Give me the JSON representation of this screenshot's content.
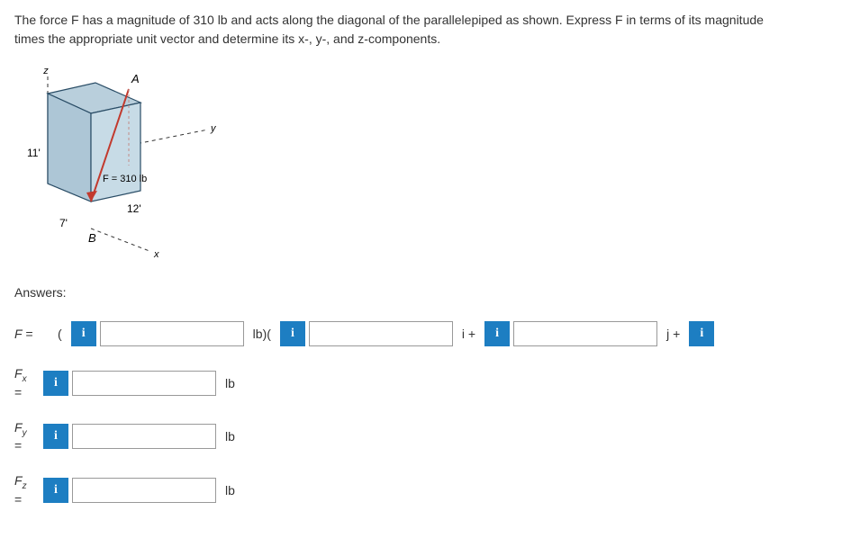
{
  "problem": {
    "line1": "The force F has a magnitude of 310 lb and acts along the diagonal of the parallelepiped as shown. Express F in terms of its magnitude",
    "line2": "times the appropriate unit vector and determine its x-, y-, and z-components."
  },
  "diagram": {
    "z_label": "z",
    "y_label": "y",
    "x_label": "x",
    "A_label": "A",
    "B_label": "B",
    "height": "11'",
    "width": "7'",
    "depth": "12'",
    "force_label": "F = 310 lb"
  },
  "answers_label": "Answers:",
  "rows": {
    "F": {
      "label": "F =",
      "open_paren": "(",
      "after1": "lb)(",
      "after2": "i +",
      "after3": "j +",
      "info_text": "i"
    },
    "Fx": {
      "var": "F",
      "sub": "x",
      "eq": "=",
      "unit": "lb",
      "info_text": "i"
    },
    "Fy": {
      "var": "F",
      "sub": "y",
      "eq": "=",
      "unit": "lb",
      "info_text": "i"
    },
    "Fz": {
      "var": "F",
      "sub": "z",
      "eq": "=",
      "unit": "lb",
      "info_text": "i"
    }
  }
}
